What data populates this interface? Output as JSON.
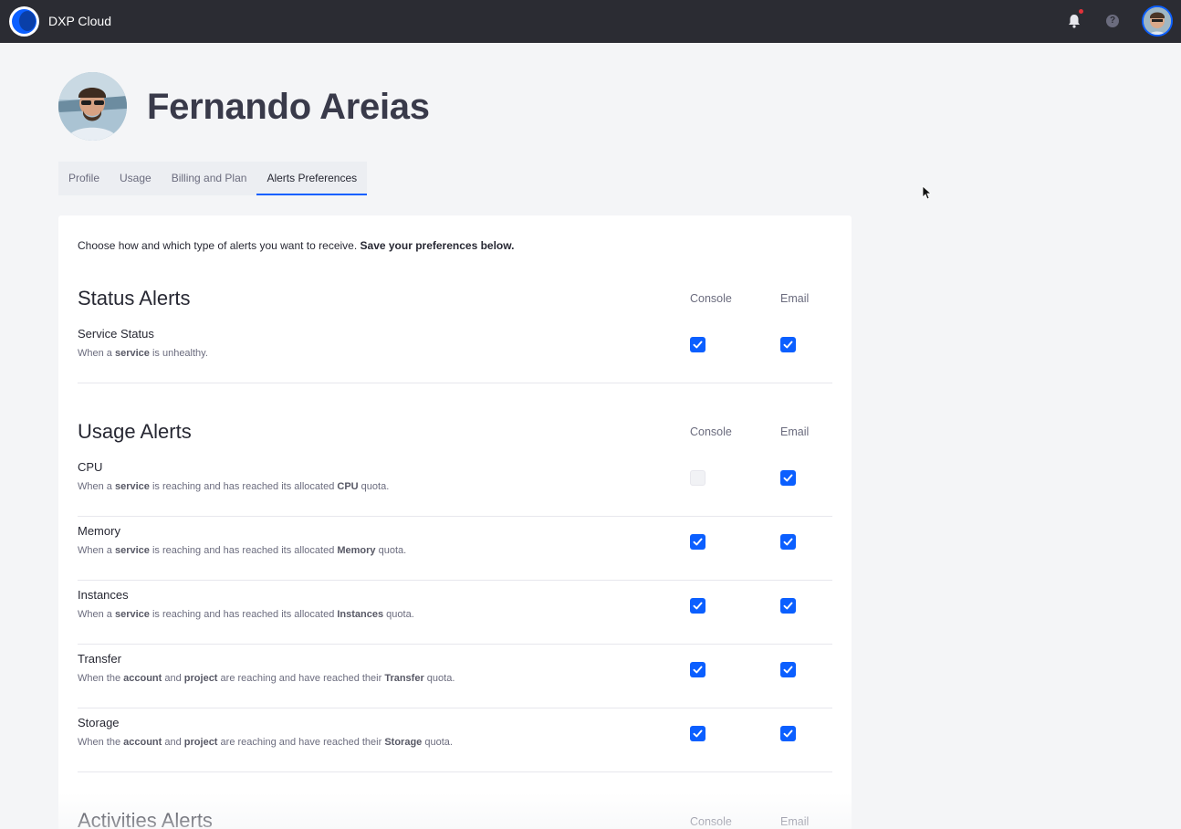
{
  "app": {
    "name": "DXP Cloud",
    "accent_color": "#0b5fff",
    "topbar_color": "#2b2c33",
    "logo_icon": "dxp-cloud-logo",
    "notifications_icon": "bell-icon",
    "help_icon": "question-circle-icon",
    "help_glyph": "?",
    "avatar_icon": "user-avatar"
  },
  "profile": {
    "name": "Fernando Areias"
  },
  "tabs": [
    {
      "label": "Profile",
      "active": false
    },
    {
      "label": "Usage",
      "active": false
    },
    {
      "label": "Billing and Plan",
      "active": false
    },
    {
      "label": "Alerts Preferences",
      "active": true
    }
  ],
  "intro": {
    "text": "Choose how and which type of alerts you want to receive.",
    "emphasis": "Save your preferences below."
  },
  "columns": {
    "console": "Console",
    "email": "Email"
  },
  "sections": [
    {
      "title": "Status Alerts",
      "rows": [
        {
          "title": "Service Status",
          "desc_parts": [
            "When a ",
            "service",
            " is unhealthy."
          ],
          "console": true,
          "email": true
        }
      ]
    },
    {
      "title": "Usage Alerts",
      "rows": [
        {
          "title": "CPU",
          "desc_parts": [
            "When a ",
            "service",
            " is reaching and has reached its allocated ",
            "CPU",
            " quota."
          ],
          "console": false,
          "email": true
        },
        {
          "title": "Memory",
          "desc_parts": [
            "When a ",
            "service",
            " is reaching and has reached its allocated ",
            "Memory",
            " quota."
          ],
          "console": true,
          "email": true
        },
        {
          "title": "Instances",
          "desc_parts": [
            "When a ",
            "service",
            " is reaching and has reached its allocated ",
            "Instances",
            " quota."
          ],
          "console": true,
          "email": true
        },
        {
          "title": "Transfer",
          "desc_parts": [
            "When the ",
            "account",
            " and ",
            "project",
            " are reaching and have reached their ",
            "Transfer",
            " quota."
          ],
          "console": true,
          "email": true
        },
        {
          "title": "Storage",
          "desc_parts": [
            "When the ",
            "account",
            " and ",
            "project",
            " are reaching and have reached their ",
            "Storage",
            " quota."
          ],
          "console": true,
          "email": true
        }
      ]
    },
    {
      "title": "Activities Alerts",
      "rows": []
    }
  ]
}
